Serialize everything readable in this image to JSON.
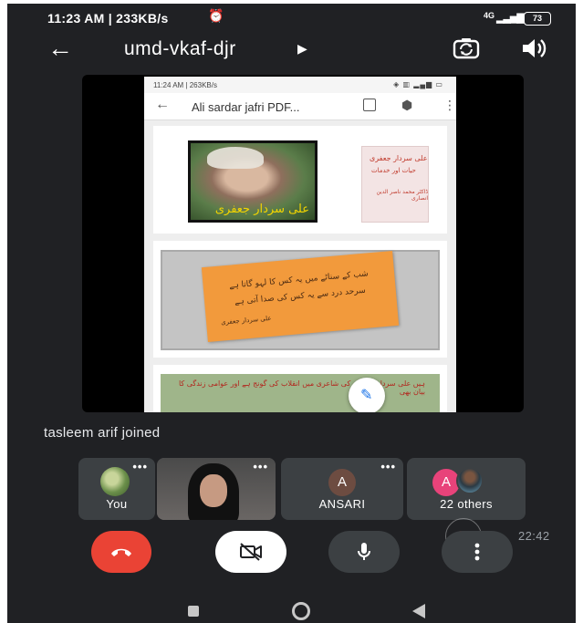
{
  "status_bar": {
    "time": "11:23 AM | 233KB/s",
    "alarm_icon": "alarm-icon",
    "network": "4G",
    "battery": "73"
  },
  "call_header": {
    "meeting_code": "umd-vkaf-djr"
  },
  "shared_screen": {
    "status_text": "11:24 AM | 263KB/s",
    "document_title": "Ali sardar jafri PDF...",
    "portrait_caption": "علی سردار جعفری",
    "cover_line1": "علی سردار جعفری",
    "cover_line2": "حیات اور خدمات",
    "cover_line3": "ڈاکٹر محمد ناصر الدین انصاری",
    "quote_line1": "شب کے سناٹے میں یہ کس کا لہو گاتا ہے",
    "quote_line2": "سرحد درد سے یہ کس کی صدا آتی ہے",
    "quote_author": "علی سردار جعفری",
    "strip_text": "ہیں علی سردار جعفری کی شاعری میں انقلاب کی گونج ہے اور عوامی زندگی کا بیان بھی"
  },
  "notification": "tasleem arif joined",
  "participants": [
    {
      "name": "You"
    },
    {
      "name": ""
    },
    {
      "name": "ANSARI",
      "initial": "A"
    },
    {
      "name": "22 others",
      "initial": "A"
    }
  ],
  "timer": "22:42",
  "colors": {
    "background": "#202124",
    "tile": "#3c4043",
    "end_call": "#ea4335",
    "accent": "#1a73e8"
  }
}
